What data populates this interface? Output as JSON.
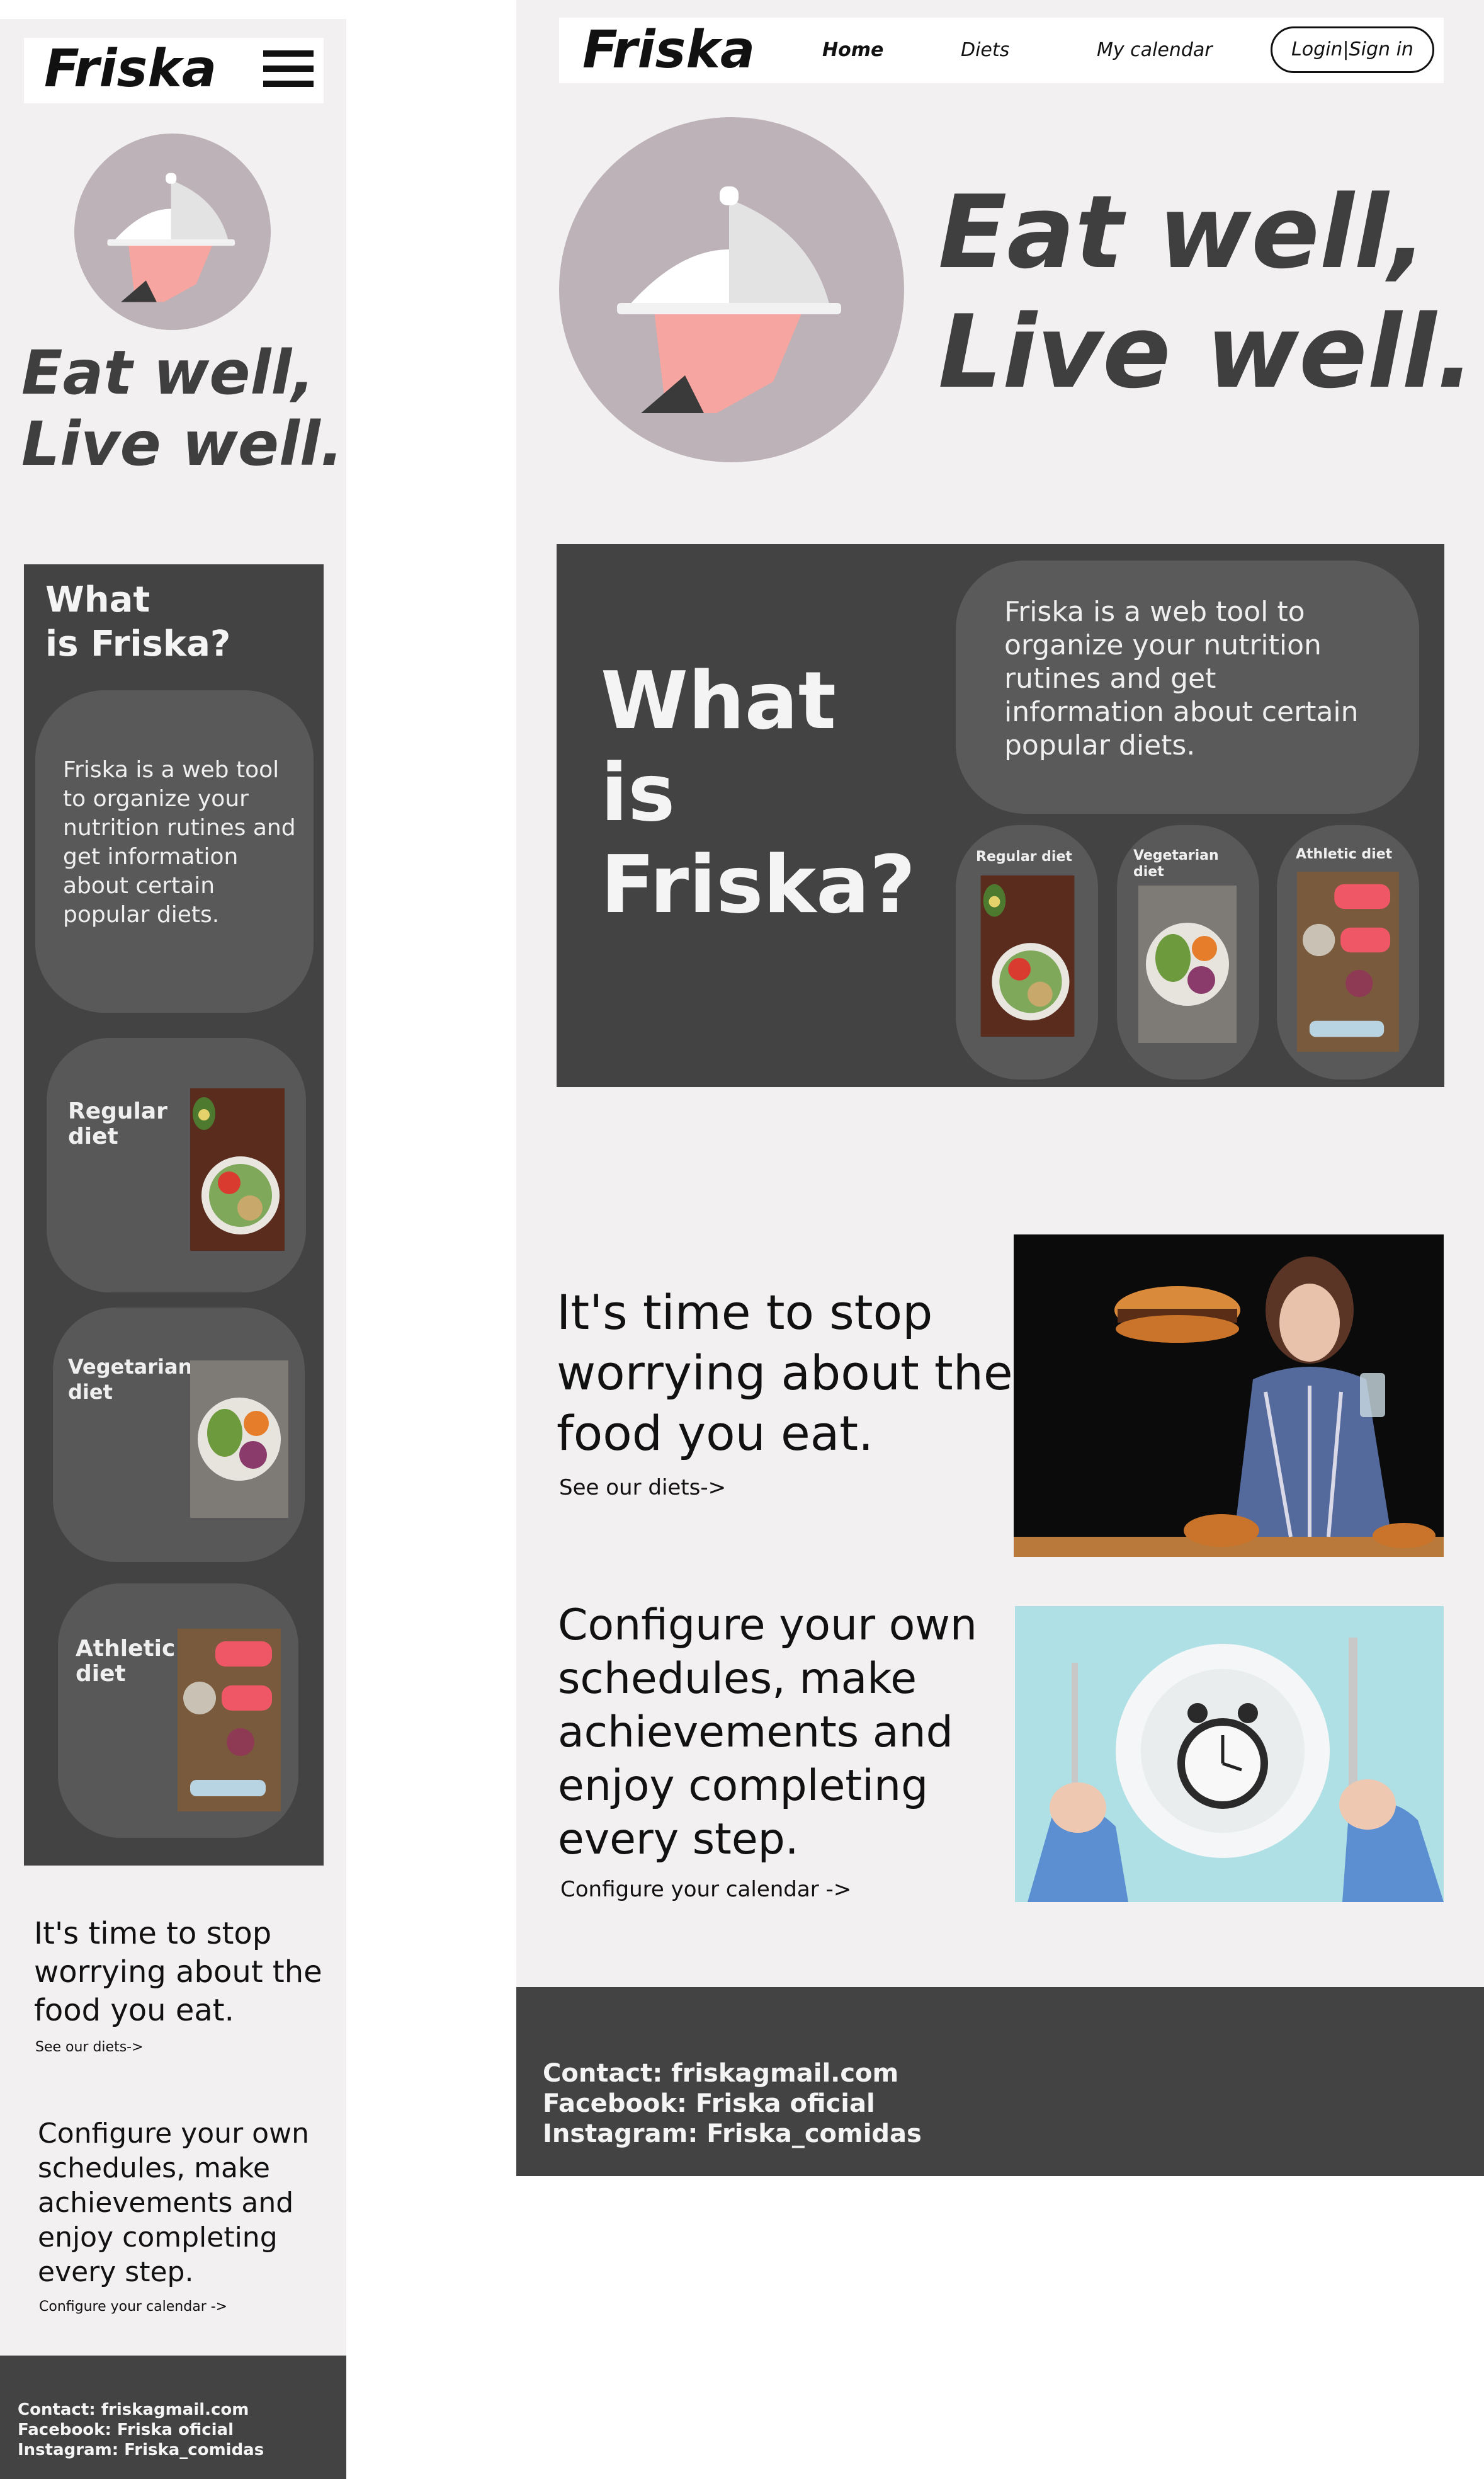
{
  "brand": {
    "name": "Friska",
    "colors": {
      "dark_panel": "#434343",
      "pill": "#595959",
      "page_bg": "#f2f0f1",
      "plate_circle": "#bdb2b7",
      "slogan": "#3f3f3f"
    }
  },
  "nav": {
    "items": [
      "Home",
      "Diets",
      "My calendar"
    ],
    "login": "Login|Sign in",
    "menu_icon": "hamburger-menu-icon"
  },
  "hero": {
    "slogan": "Eat well,\nLive well.",
    "icon": "serving-cloche-icon"
  },
  "what": {
    "title_mobile": "What\nis Friska?",
    "title_desktop": "What\nis\nFriska?",
    "description": "Friska is a web tool to organize your nutrition rutines and get information about certain popular diets.",
    "diets_mobile": [
      "Regular\ndiet",
      "Vegetarian\ndiet",
      "Athletic\ndiet"
    ],
    "diets_desktop": [
      "Regular diet",
      "Vegetarian\ndiet",
      "Athletic diet"
    ]
  },
  "promo": {
    "stop": "It's time to stop worrying about the food you eat.",
    "stop_link": "See our diets->",
    "config": "Configure your own schedules, make achievements and enjoy completing every step.",
    "config_link": "Configure your calendar ->"
  },
  "footer": {
    "text": "Contact: friskagmail.com\nFacebook: Friska oficial\nInstagram: Friska_comidas"
  }
}
